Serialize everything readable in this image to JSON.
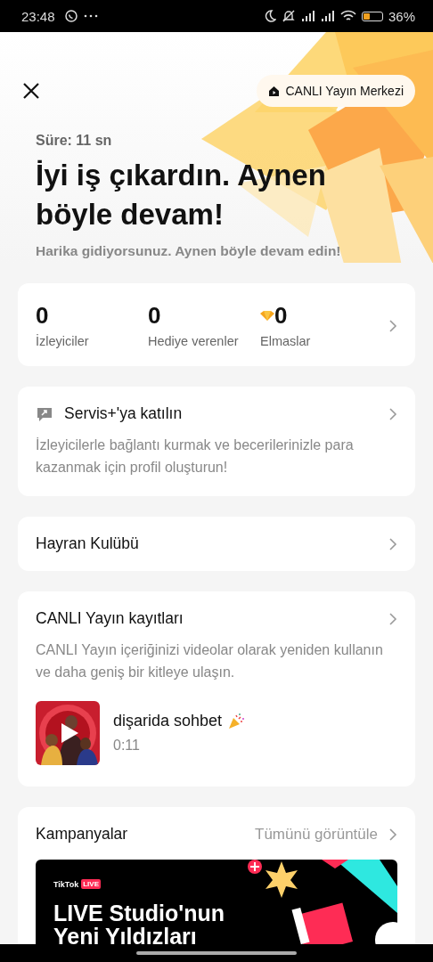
{
  "status_bar": {
    "time": "23:48",
    "battery": "36%"
  },
  "header": {
    "live_center_button": "CANLI Yayın Merkezi"
  },
  "summary": {
    "duration": "Süre: 11 sn",
    "title": "İyi iş çıkardın. Aynen böyle devam!",
    "subtitle": "Harika gidiyorsunuz. Aynen böyle devam edin!"
  },
  "stats": [
    {
      "value": "0",
      "label": "İzleyiciler",
      "kind": "plain"
    },
    {
      "value": "0",
      "label": "Hediye verenler",
      "kind": "plain"
    },
    {
      "value": "0",
      "label": "Elmaslar",
      "kind": "diamond"
    }
  ],
  "service": {
    "title": "Servis+'ya katılın",
    "description": "İzleyicilerle bağlantı kurmak ve becerilerinizle para kazanmak için profil oluşturun!"
  },
  "fan_club": {
    "title": "Hayran Kulübü"
  },
  "recordings": {
    "title": "CANLI Yayın kayıtları",
    "description": "CANLI Yayın içeriğinizi videolar olarak yeniden kullanın ve daha geniş bir kitleye ulaşın.",
    "items": [
      {
        "title": "dişarida sohbet",
        "duration": "0:11"
      }
    ]
  },
  "campaigns": {
    "title": "Kampanyalar",
    "view_all": "Tümünü görüntüle",
    "banner": {
      "brand": "TikTok",
      "badge": "LIVE",
      "headline": "LIVE Studio'nun Yeni Yıldızları"
    }
  }
}
